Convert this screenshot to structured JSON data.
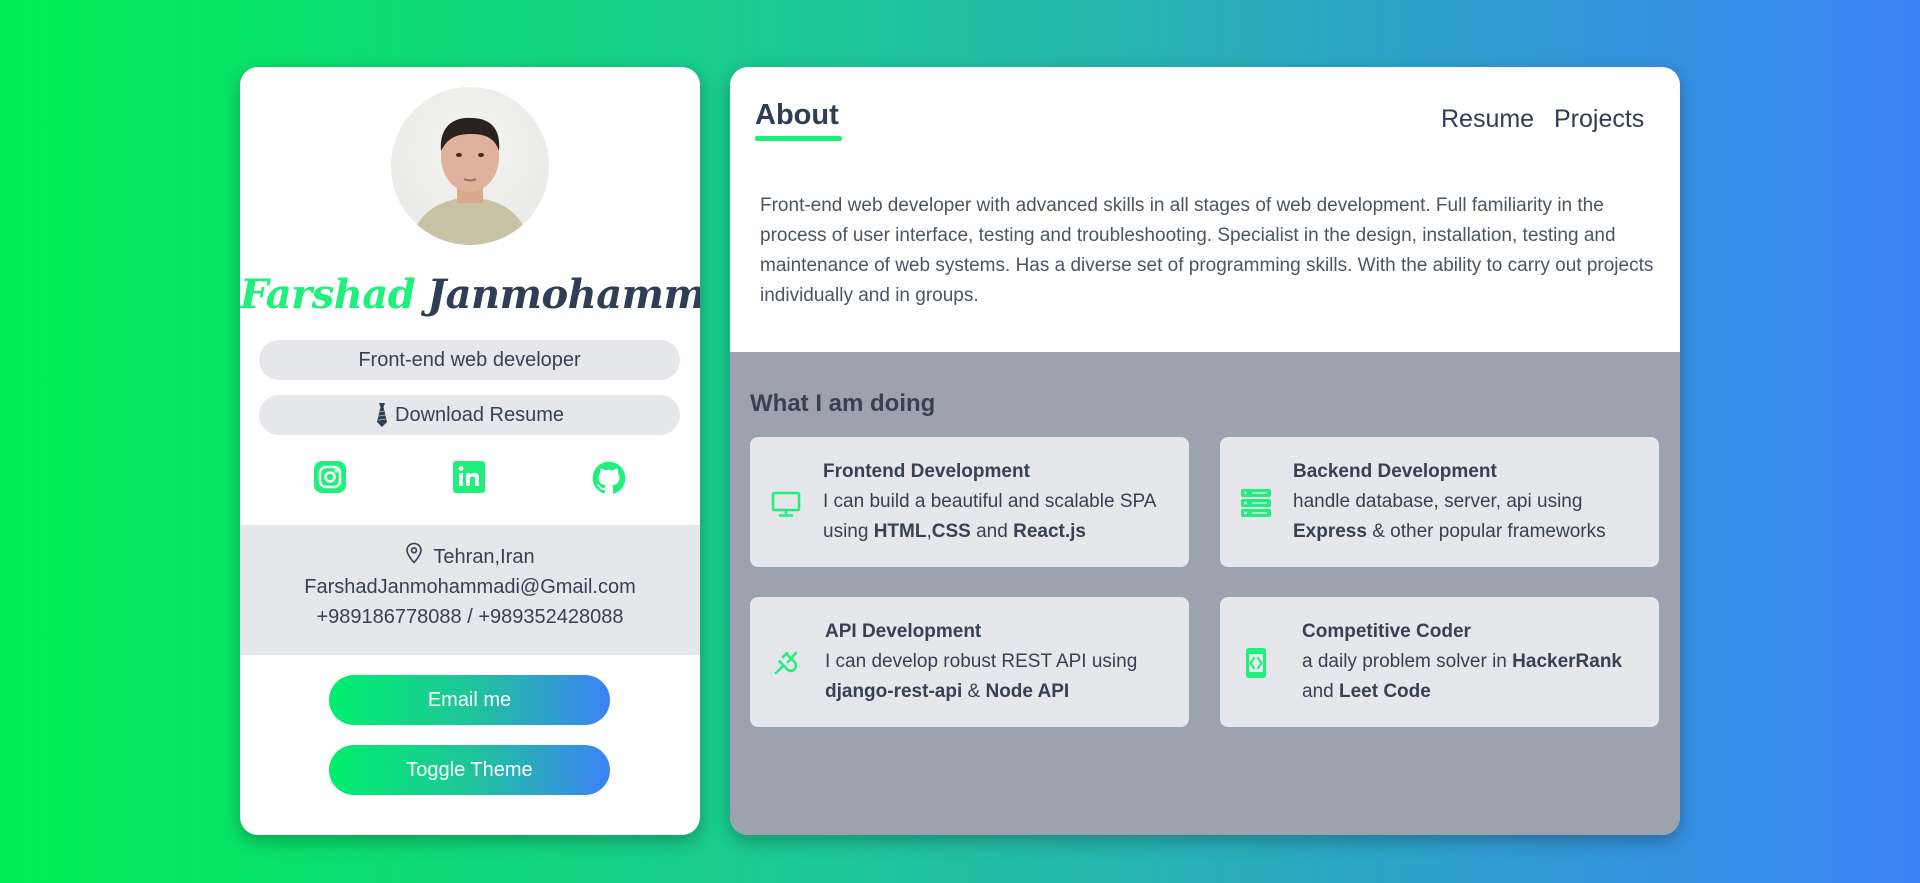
{
  "profile": {
    "first_name": "Farshad",
    "last_name": "Janmohammadi",
    "role": "Front-end web developer",
    "download_label": "Download Resume",
    "socials": [
      "instagram-icon",
      "linkedin-icon",
      "github-icon"
    ],
    "location": "Tehran,Iran",
    "email": "FarshadJanmohammadi@Gmail.com",
    "phones": "+989186778088 / +989352428088",
    "email_button": "Email me",
    "theme_button": "Toggle Theme"
  },
  "header": {
    "title": "About",
    "nav": [
      "Resume",
      "Projects"
    ]
  },
  "about": {
    "text": "Front-end web developer with advanced skills in all stages of web development. Full familiarity in the process of user interface, testing and troubleshooting. Specialist in the design, installation, testing and maintenance of web systems. Has a diverse set of programming skills. With the ability to carry out projects individually and in groups."
  },
  "doing": {
    "title": "What I am doing",
    "services": [
      {
        "title": "Frontend Development",
        "icon": "monitor-icon",
        "p1": "I can build a beautiful and scalable SPA using ",
        "b1": "HTML",
        "p2": ",",
        "b2": "CSS",
        "p3": " and ",
        "b3": "React.js",
        "p4": ""
      },
      {
        "title": "Backend Development",
        "icon": "server-icon",
        "p1": "handle database, server, api using ",
        "b1": "Express",
        "p2": " & other popular frameworks"
      },
      {
        "title": "API Development",
        "icon": "plug-icon",
        "p1": "I can develop robust REST API using ",
        "b1": "django-rest-api",
        "p2": " & ",
        "b2": "Node API"
      },
      {
        "title": "Competitive Coder",
        "icon": "code-icon",
        "p1": "a daily problem solver in ",
        "b1": "HackerRank",
        "p2": " and ",
        "b2": "Leet Code"
      }
    ]
  },
  "colors": {
    "accent": "#1ff07c",
    "dark_text": "#2f3d55",
    "gray_panel": "#e5e7eb",
    "section_bg": "#9ca3af",
    "gradient_end": "#3b82f6"
  }
}
